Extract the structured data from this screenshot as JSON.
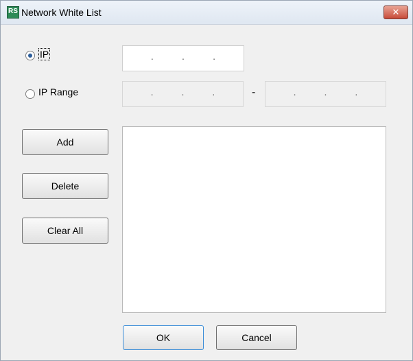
{
  "window": {
    "title": "Network White List",
    "app_icon_text": "RS",
    "close_glyph": "✕"
  },
  "ip_option": {
    "label": "IP",
    "selected": true,
    "value": [
      " ",
      " ",
      " ",
      " "
    ]
  },
  "ip_range_option": {
    "label": "IP Range",
    "selected": false,
    "start": [
      " ",
      " ",
      " ",
      " "
    ],
    "end": [
      " ",
      " ",
      " ",
      " "
    ],
    "separator": "-"
  },
  "actions": {
    "add": "Add",
    "delete": "Delete",
    "clear_all": "Clear All"
  },
  "white_list": {
    "items": []
  },
  "dialog_buttons": {
    "ok": "OK",
    "cancel": "Cancel"
  }
}
